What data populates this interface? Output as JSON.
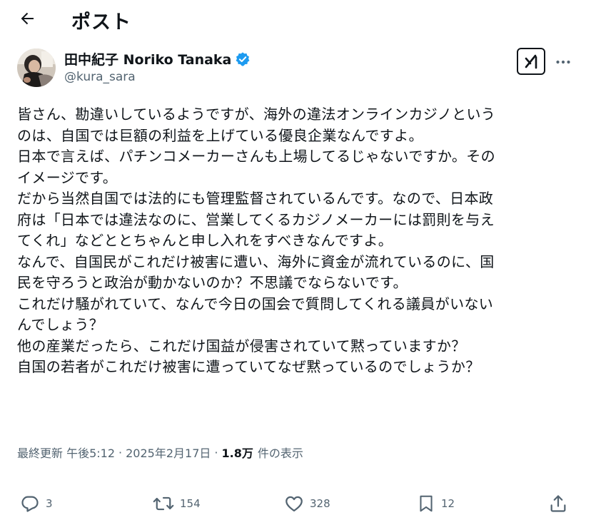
{
  "header": {
    "title": "ポスト"
  },
  "author": {
    "display_name": "田中紀子 Noriko Tanaka",
    "handle": "@kura_sara",
    "verified": true
  },
  "post": {
    "lines": [
      "皆さん、勘違いしているようですが、海外の違法オンラインカジノという",
      "のは、自国では巨額の利益を上げている優良企業なんですよ。",
      "日本で言えば、パチンコメーカーさんも上場してるじゃないですか。その",
      "イメージです。",
      "だから当然自国では法的にも管理監督されているんです。なので、日本政",
      "府は「日本では違法なのに、営業してくるカジノメーカーには罰則を与え",
      "てくれ」などととちゃんと申し入れをすべきなんですよ。",
      "なんで、自国民がこれだけ被害に遭い、海外に資金が流れているのに、国",
      "民を守ろうと政治が動かないのか？不思議でならないです。",
      "これだけ騒がれていて、なんで今日の国会で質問してくれる議員がいない",
      "んでしょう？",
      "他の産業だったら、これだけ国益が侵害されていて黙っていますか？",
      "自国の若者がこれだけ被害に遭っていてなぜ黙っているのでしょうか？"
    ]
  },
  "meta": {
    "updated_time": "最終更新 午後5:12",
    "separator": "·",
    "date": "2025年2月17日",
    "views_count": "1.8万",
    "views_label": "件の表示"
  },
  "actions": {
    "reply_count": "3",
    "repost_count": "154",
    "like_count": "328",
    "bookmark_count": "12"
  },
  "icons": {
    "back": "arrow-left-icon",
    "verified": "verified-badge-icon",
    "grok": "grok-icon",
    "more": "more-horizontal-icon",
    "reply": "reply-icon",
    "repost": "repost-icon",
    "like": "heart-icon",
    "bookmark": "bookmark-icon",
    "share": "share-icon"
  },
  "colors": {
    "text": "#0f1419",
    "secondary": "#536471",
    "verified": "#1d9bf0"
  }
}
